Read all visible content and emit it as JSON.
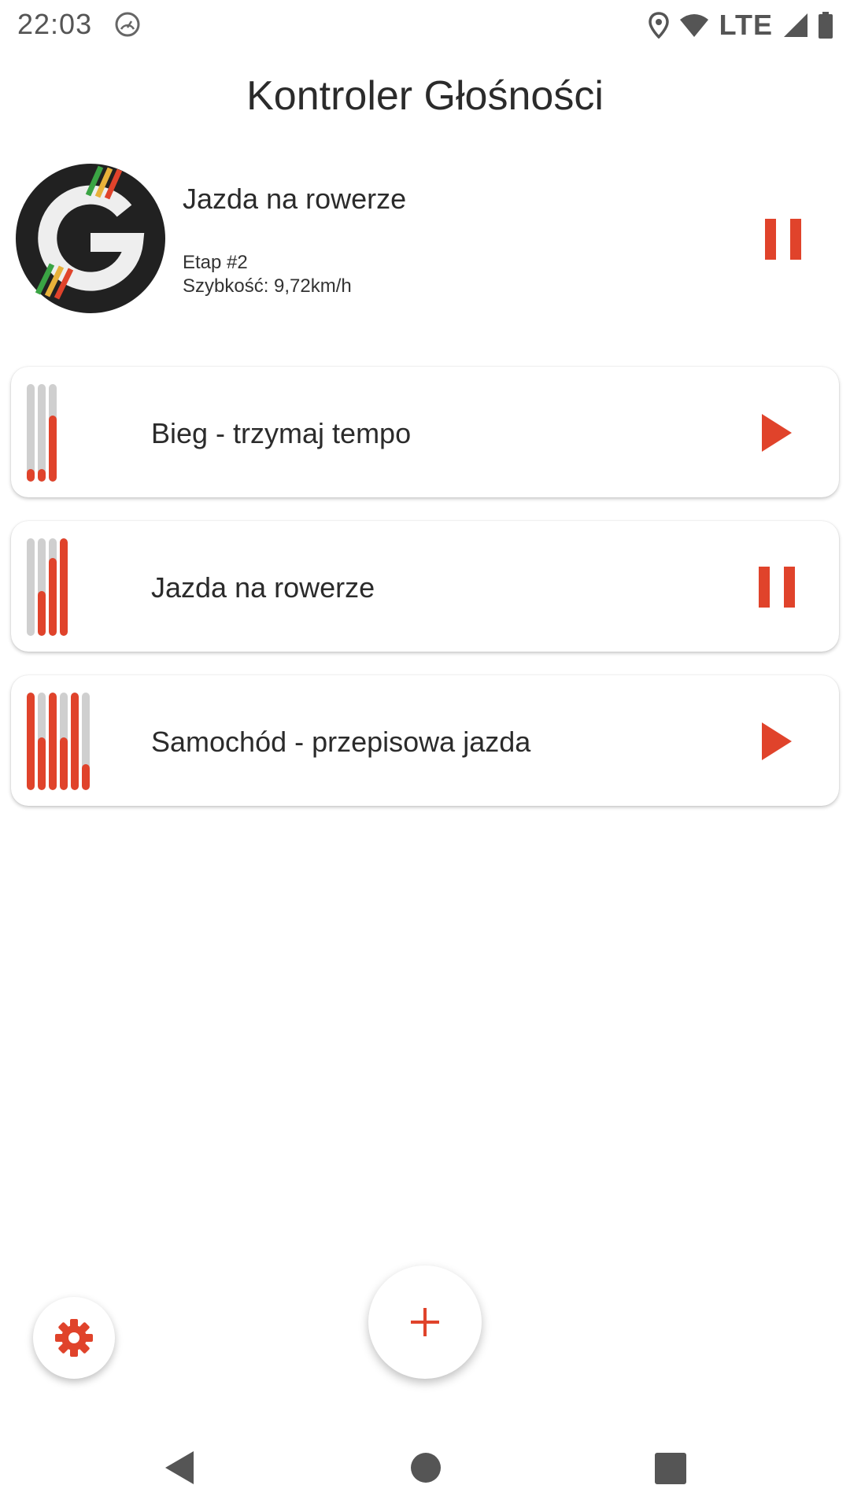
{
  "status_bar": {
    "time": "22:03",
    "network": "LTE",
    "icons": [
      "speedometer-icon",
      "location-icon",
      "wifi-icon",
      "signal-icon",
      "battery-icon"
    ]
  },
  "app": {
    "title": "Kontroler Głośności",
    "accent_color": "#e0432b"
  },
  "now_playing": {
    "title": "Jazda na rowerze",
    "stage": "Etap #2",
    "speed": "Szybkość: 9,72km/h",
    "state": "playing",
    "control_icon": "pause-icon"
  },
  "profiles": [
    {
      "label": "Bieg - trzymaj tempo",
      "control_icon": "play-icon",
      "volume_levels": [
        0.13,
        0.13,
        0.68
      ]
    },
    {
      "label": "Jazda na rowerze",
      "control_icon": "pause-icon",
      "volume_levels": [
        0.0,
        0.46,
        0.8,
        1.0
      ]
    },
    {
      "label": "Samochód - przepisowa jazda",
      "control_icon": "play-icon",
      "volume_levels": [
        1.0,
        0.54,
        1.0,
        0.54,
        1.0,
        0.27
      ]
    }
  ],
  "fab": {
    "settings_icon": "gear-icon",
    "add_icon": "plus-icon"
  },
  "nav_bar": {
    "icons": [
      "back-icon",
      "home-icon",
      "recents-icon"
    ]
  }
}
